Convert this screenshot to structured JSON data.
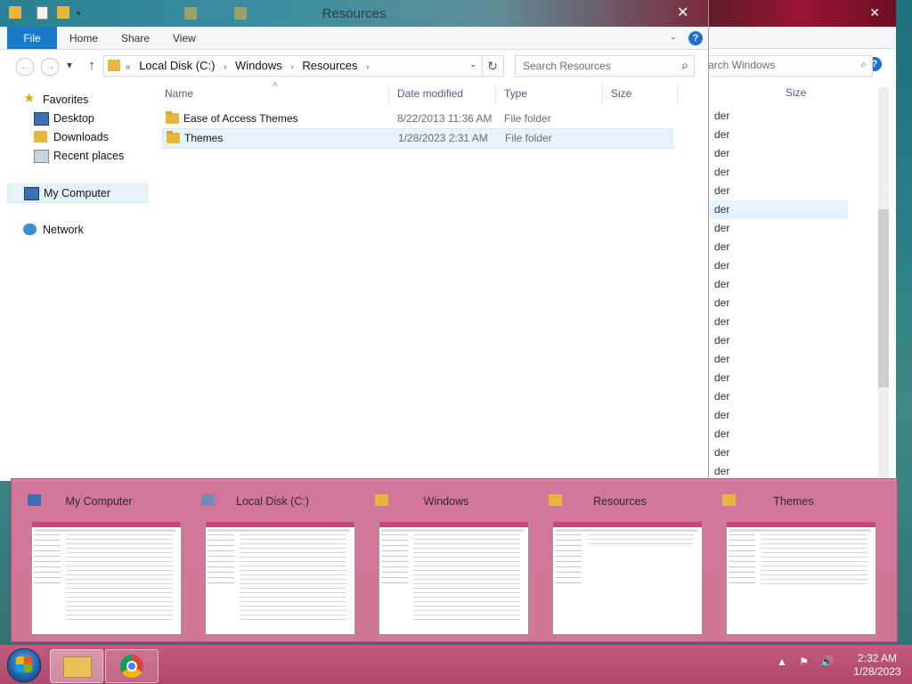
{
  "main_window": {
    "title": "Resources",
    "close_glyph": "✕",
    "ribbon": {
      "tabs": [
        "File",
        "Home",
        "Share",
        "View"
      ],
      "help_glyph": "?",
      "expand_glyph": "⌄"
    },
    "nav": {
      "back_glyph": "←",
      "forward_glyph": "→",
      "up_glyph": "↑",
      "breadcrumb": [
        "Local Disk (C:)",
        "Windows",
        "Resources"
      ],
      "overflow_glyph": "«",
      "sep_glyph": "›",
      "dropdown_glyph": "⌄",
      "refresh_glyph": "↻",
      "search_placeholder": "Search Resources",
      "search_glyph": "⌕"
    },
    "sidebar": {
      "favorites_label": "Favorites",
      "items": [
        "Desktop",
        "Downloads",
        "Recent places"
      ],
      "computer_label": "My Computer",
      "network_label": "Network"
    },
    "columns": {
      "name": "Name",
      "date": "Date modified",
      "type": "Type",
      "size": "Size",
      "sort_glyph": "˄"
    },
    "files": [
      {
        "name": "Ease of Access Themes",
        "date": "8/22/2013 11:36 AM",
        "type": "File folder"
      },
      {
        "name": "Themes",
        "date": "1/28/2023 2:31 AM",
        "type": "File folder"
      }
    ]
  },
  "background_window": {
    "search_placeholder": "arch Windows",
    "size_header": "Size",
    "row_fragment": "der",
    "close_glyph": "✕"
  },
  "thumbnails": [
    {
      "label": "My Computer",
      "icon": "computer-icon"
    },
    {
      "label": "Local Disk (C:)",
      "icon": "drive-icon"
    },
    {
      "label": "Windows",
      "icon": "folder-icon"
    },
    {
      "label": "Resources",
      "icon": "folder-icon"
    },
    {
      "label": "Themes",
      "icon": "folder-icon"
    }
  ],
  "taskbar": {
    "tray_glyphs": [
      "▲",
      "⚑",
      "🔊"
    ],
    "time": "2:32 AM",
    "date": "1/28/2023"
  },
  "colors": {
    "accent": "#1979ca",
    "selection": "#e5f3fb",
    "folder": "#e6b73a",
    "flyout": "#e0769b",
    "taskbar": "#b0476b"
  }
}
